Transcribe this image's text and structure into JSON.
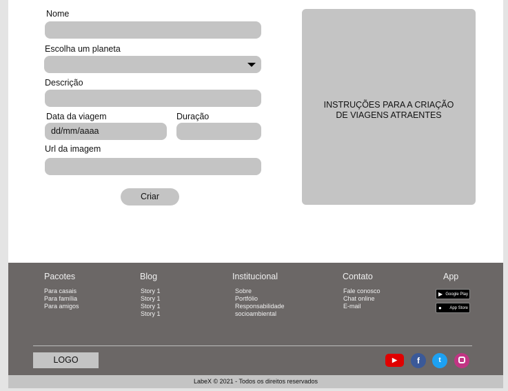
{
  "form": {
    "nome_label": "Nome",
    "planeta_label": "Escolha um planeta",
    "descricao_label": "Descrição",
    "data_label": "Data da viagem",
    "data_placeholder": "dd/mm/aaaa",
    "duracao_label": "Duração",
    "url_label": "Url da imagem",
    "submit_label": "Criar"
  },
  "instructions": {
    "line1": "INSTRUÇÕES PARA A CRIAÇÃO",
    "line2": "DE VIAGENS ATRAENTES"
  },
  "footer": {
    "pacotes": {
      "title": "Pacotes",
      "items": [
        "Para casais",
        "Para família",
        "Para amigos"
      ]
    },
    "blog": {
      "title": "Blog",
      "items": [
        "Story 1",
        "Story 1",
        "Story 1",
        "Story 1"
      ]
    },
    "institucional": {
      "title": "Institucional",
      "items": [
        "Sobre",
        "Portfólio",
        "Responsabilidade",
        "socioambiental"
      ]
    },
    "contato": {
      "title": "Contato",
      "items": [
        "Fale conosco",
        "Chat online",
        "E-mail"
      ]
    },
    "app": {
      "title": "App",
      "google_play": "Google Play",
      "app_store": "App Store"
    },
    "logo": "LOGO",
    "social_icons": [
      "youtube-icon",
      "facebook-icon",
      "twitter-icon",
      "instagram-icon"
    ],
    "copyright": "LabeX © 2021 - Todos os direitos reservados"
  }
}
